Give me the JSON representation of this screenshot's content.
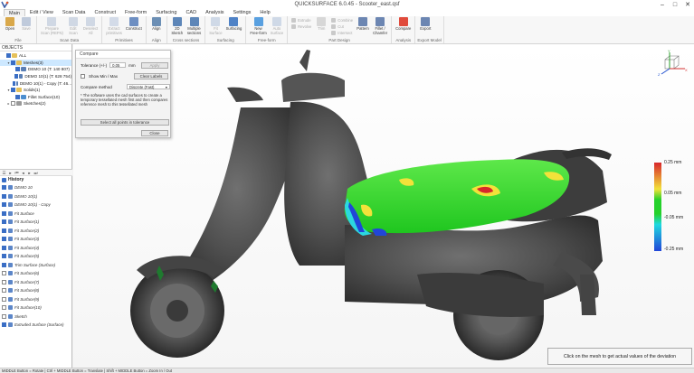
{
  "window": {
    "title": "QUICKSURFACE 6.0.45 - Scooter_east.qsf"
  },
  "menu": {
    "items": [
      "Main",
      "Edit / View",
      "Scan Data",
      "Construct",
      "Free-form",
      "Surfacing",
      "CAD",
      "Analysis",
      "Settings",
      "Help"
    ],
    "active": "Main"
  },
  "ribbon": {
    "groups": [
      {
        "label": "File",
        "buttons": [
          {
            "label": "Open",
            "icon": "open-folder-icon",
            "color": "#d9a84a"
          },
          {
            "label": "Save",
            "icon": "save-icon",
            "color": "#7a93b8",
            "disabled": true
          }
        ]
      },
      {
        "label": "Scan Data",
        "buttons": [
          {
            "label": "Prepare\nScan (REFN)",
            "icon": "prepare-scan-icon",
            "color": "#9fb2cc",
            "disabled": true
          },
          {
            "label": "Edit\nScan",
            "icon": "edit-scan-icon",
            "color": "#9fb2cc",
            "disabled": true
          },
          {
            "label": "Deselect\nAll",
            "icon": "deselect-icon",
            "color": "#9fb2cc",
            "disabled": true
          }
        ]
      },
      {
        "label": "Primitives",
        "buttons": [
          {
            "label": "Extract\nprimitives",
            "icon": "extract-primitives-icon",
            "color": "#a7b9d4",
            "disabled": true
          },
          {
            "label": "Construct",
            "icon": "construct-icon",
            "color": "#6e8fc2"
          }
        ]
      },
      {
        "label": "Align",
        "buttons": [
          {
            "label": "Align",
            "icon": "align-icon",
            "color": "#6c8fb5"
          }
        ]
      },
      {
        "label": "Cross sections",
        "buttons": [
          {
            "label": "2D\nSketch",
            "icon": "sketch-2d-icon",
            "color": "#5d86b8"
          },
          {
            "label": "Multiple\nsections",
            "icon": "multiple-sections-icon",
            "color": "#5d86b8"
          }
        ]
      },
      {
        "label": "Surfacing",
        "buttons": [
          {
            "label": "Fit\nSurface",
            "icon": "fit-surface-icon",
            "color": "#9db4d2",
            "disabled": true
          },
          {
            "label": "Surfacing",
            "icon": "surfacing-icon",
            "color": "#4f82c6"
          }
        ]
      },
      {
        "label": "Free-form",
        "buttons": [
          {
            "label": "New\nFree-form",
            "icon": "new-freeform-icon",
            "color": "#59a0e0"
          },
          {
            "label": "Auto\nSurface",
            "icon": "auto-surface-icon",
            "color": "#9db4d2",
            "disabled": true
          }
        ]
      },
      {
        "label": "Part Design",
        "small": [
          "Extrude",
          "Revolve"
        ],
        "buttons": [
          {
            "label": "Trim",
            "icon": "trim-icon",
            "color": "#b0b0b0",
            "disabled": true
          }
        ],
        "small2": [
          "Combine",
          "Cut",
          "Intersect"
        ],
        "buttons2": [
          {
            "label": "Pattern",
            "icon": "pattern-icon",
            "color": "#6c86b2"
          },
          {
            "label": "Fillet /\nChamfer",
            "icon": "fillet-icon",
            "color": "#6c86b2"
          }
        ]
      },
      {
        "label": "Analysis",
        "buttons": [
          {
            "label": "Compare",
            "icon": "compare-icon",
            "color": "#e04b3c"
          }
        ]
      },
      {
        "label": "Export Model",
        "buttons": [
          {
            "label": "Export",
            "icon": "export-icon",
            "color": "#6c86b2"
          }
        ]
      }
    ]
  },
  "objects_panel": {
    "header": "OBJECTS",
    "tree": [
      {
        "label": "ALL",
        "level": 0,
        "icon": "folder",
        "exp": ""
      },
      {
        "label": "Meshes(3)",
        "level": 1,
        "icon": "folder",
        "exp": "▾",
        "selected": true
      },
      {
        "label": "DEMO 10 (T: 140 807)",
        "level": 2,
        "icon": "mesh",
        "exp": ""
      },
      {
        "label": "DEMO 10(1) (T: 628 754)",
        "level": 2,
        "icon": "mesh",
        "exp": ""
      },
      {
        "label": "DEMO 10(1) - Copy (T: 46...",
        "level": 2,
        "icon": "mesh",
        "exp": ""
      },
      {
        "label": "Solids(1)",
        "level": 1,
        "icon": "folder",
        "exp": "▾"
      },
      {
        "label": "Fillet Surface(10)",
        "level": 2,
        "icon": "surf",
        "exp": ""
      },
      {
        "label": "Sketches(2)",
        "level": 1,
        "icon": "sketch",
        "exp": "▸",
        "off": true
      }
    ]
  },
  "history_panel": {
    "header": "History",
    "items": [
      {
        "label": "DEMO 10",
        "checked": true
      },
      {
        "label": "DEMO 10(1)",
        "checked": true
      },
      {
        "label": "DEMO 10(1) - Copy",
        "checked": true
      },
      {
        "label": "Fit Surface",
        "checked": true
      },
      {
        "label": "Fit Surface(1)",
        "checked": true
      },
      {
        "label": "Fit Surface(2)",
        "checked": true
      },
      {
        "label": "Fit Surface(3)",
        "checked": true
      },
      {
        "label": "Fit Surface(4)",
        "checked": true
      },
      {
        "label": "Fit Surface(5)",
        "checked": true
      },
      {
        "label": "Trim Surface (Surface)",
        "checked": true
      },
      {
        "label": "Fit Surface(6)",
        "checked": false
      },
      {
        "label": "Fit Surface(7)",
        "checked": false
      },
      {
        "label": "Fit Surface(8)",
        "checked": false
      },
      {
        "label": "Fit Surface(9)",
        "checked": false
      },
      {
        "label": "Fit Surface(10)",
        "checked": false
      },
      {
        "label": "Sketch",
        "checked": false
      },
      {
        "label": "Extruded Surface (Surface)",
        "checked": true
      }
    ]
  },
  "compare_dialog": {
    "title": "Compare",
    "tolerance_label": "Tolerance (+/-)",
    "tolerance_value": "0.05",
    "tolerance_unit": "mm",
    "apply_label": "Apply",
    "show_minmax_label": "Show Min / Max",
    "clear_labels": "Clear Labels",
    "method_label": "Compare method",
    "method_value": "Discrete (Fast)",
    "note": "The software uses the cad surfaces to create a temporary tessellated mesh first and then compares reference mesh to this tessellated mesh",
    "select_all_label": "Select all points in tolerance",
    "close_label": "Close"
  },
  "legend": {
    "labels": [
      "0.25 mm",
      "0.05 mm",
      "-0.05 mm",
      "-0.25 mm"
    ],
    "colors": {
      "red": "#d8262b",
      "yellow": "#f2e23a",
      "green": "#25d12b",
      "cyan": "#1fd9e0",
      "blue": "#2146d8"
    }
  },
  "tooltip": "Click on the mesh to get actual values of the deviation",
  "status_bar": "MIDDLE Button = Rotate | Ctrl + MIDDLE Button = Translate | Shift + MIDDLE Button = Zoom In / Out"
}
